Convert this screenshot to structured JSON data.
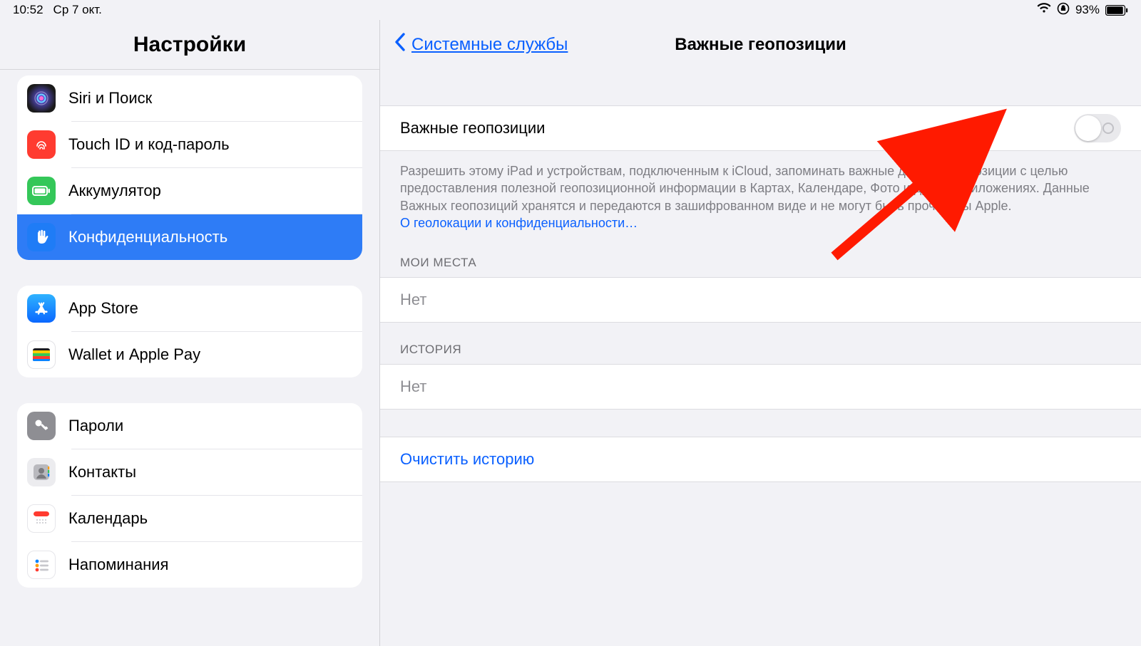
{
  "statusbar": {
    "time": "10:52",
    "date": "Ср 7 окт.",
    "battery_pct": "93%"
  },
  "sidebar": {
    "title": "Настройки",
    "groups": [
      {
        "items": [
          {
            "key": "siri",
            "label": "Siri и Поиск",
            "icon": "siri-icon",
            "bg": "#141414"
          },
          {
            "key": "touchid",
            "label": "Touch ID и код‑пароль",
            "icon": "fingerprint-icon",
            "bg": "#ff3b30"
          },
          {
            "key": "battery",
            "label": "Аккумулятор",
            "icon": "battery-icon",
            "bg": "#34c759"
          },
          {
            "key": "privacy",
            "label": "Конфиденциальность",
            "icon": "hand-icon",
            "bg": "#1f7cf6",
            "selected": true
          }
        ]
      },
      {
        "items": [
          {
            "key": "appstore",
            "label": "App Store",
            "icon": "appstore-icon",
            "bg": "#0a84ff"
          },
          {
            "key": "wallet",
            "label": "Wallet и Apple Pay",
            "icon": "wallet-icon",
            "bg": "#000000"
          }
        ]
      },
      {
        "items": [
          {
            "key": "passwords",
            "label": "Пароли",
            "icon": "key-icon",
            "bg": "#8e8e93"
          },
          {
            "key": "contacts",
            "label": "Контакты",
            "icon": "contacts-icon",
            "bg": "#d9d9de"
          },
          {
            "key": "calendar",
            "label": "Календарь",
            "icon": "calendar-icon",
            "bg": "#ffffff"
          },
          {
            "key": "reminders",
            "label": "Напоминания",
            "icon": "reminders-icon",
            "bg": "#ffffff"
          }
        ]
      }
    ]
  },
  "detail": {
    "back_label": "Системные службы",
    "title": "Важные геопозиции",
    "toggle_label": "Важные геопозиции",
    "toggle_on": false,
    "description": "Разрешить этому iPad и устройствам, подключенным к iCloud, запоминать важные для Вас геопозиции с целью предоставления полезной геопозиционной информации в Картах, Календаре, Фото и других приложениях. Данные Важных геопозиций хранятся и передаются в зашифрованном виде и не могут быть прочитаны Apple.",
    "privacy_link": "О геолокации и конфиденциальности…",
    "section_places": "МОИ МЕСТА",
    "places_value": "Нет",
    "section_history": "ИСТОРИЯ",
    "history_value": "Нет",
    "clear_history": "Очистить историю"
  }
}
